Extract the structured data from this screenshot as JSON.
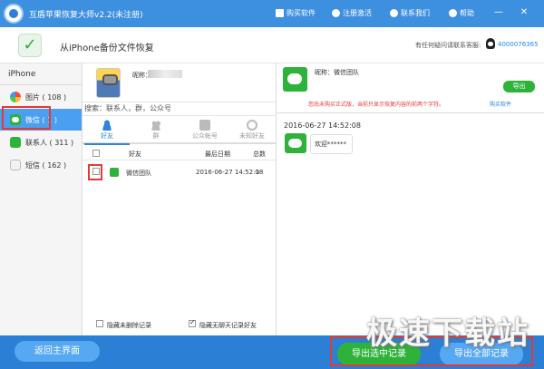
{
  "titlebar": {
    "title": "互盾苹果恢复大师v2.2(未注册)",
    "buy": "购买软件",
    "register": "注册激活",
    "contact": "联系我们",
    "help": "帮助",
    "minimize": "—",
    "close": "✕"
  },
  "header": {
    "title": "从iPhone备份文件恢复",
    "help_text": "有任何疑问请联系客服:",
    "phone": "4000076365"
  },
  "sidebar": {
    "heading": "iPhone",
    "items": [
      {
        "label": "图片 ( 108 )",
        "icon": "photos-icon"
      },
      {
        "label": "微信 ( 1 )",
        "icon": "wechat-icon",
        "active": true
      },
      {
        "label": "联系人 ( 311 )",
        "icon": "contacts-icon"
      },
      {
        "label": "短信 ( 162 )",
        "icon": "sms-icon"
      }
    ]
  },
  "account": {
    "nickname_label": "昵称："
  },
  "search": {
    "placeholder": "搜索：联系人，群，公众号"
  },
  "tabs": [
    {
      "label": "好友",
      "active": true
    },
    {
      "label": "群"
    },
    {
      "label": "公众帐号"
    },
    {
      "label": "未知好友"
    }
  ],
  "table": {
    "headers": [
      "好友",
      "最后日期",
      "总数"
    ],
    "rows": [
      {
        "name": "微信团队",
        "date": "2016-06-27 14:52:08",
        "total": "1",
        "checked": false
      }
    ]
  },
  "options": {
    "hide_deleted": "隐藏未删除记录",
    "hide_no_chat": "隐藏无聊天记录好友",
    "hide_no_chat_checked": true
  },
  "chat": {
    "nickname": "昵称：微信团队",
    "export": "导出",
    "warning": "您尚未购买正式版，当前只显示恢复内容的前两个字符。",
    "buy": "购买软件",
    "time": "2016-06-27 14:52:08",
    "message": "欢迎******"
  },
  "footer": {
    "back": "返回主界面",
    "export_selected": "导出选中记录",
    "export_all": "导出全部记录"
  },
  "watermark": "极速下载站",
  "colors": {
    "titlebar": "#3d8fe0",
    "wechat_green": "#2eb33a",
    "highlight_red": "#e53935",
    "footer": "#2b7fd4"
  }
}
